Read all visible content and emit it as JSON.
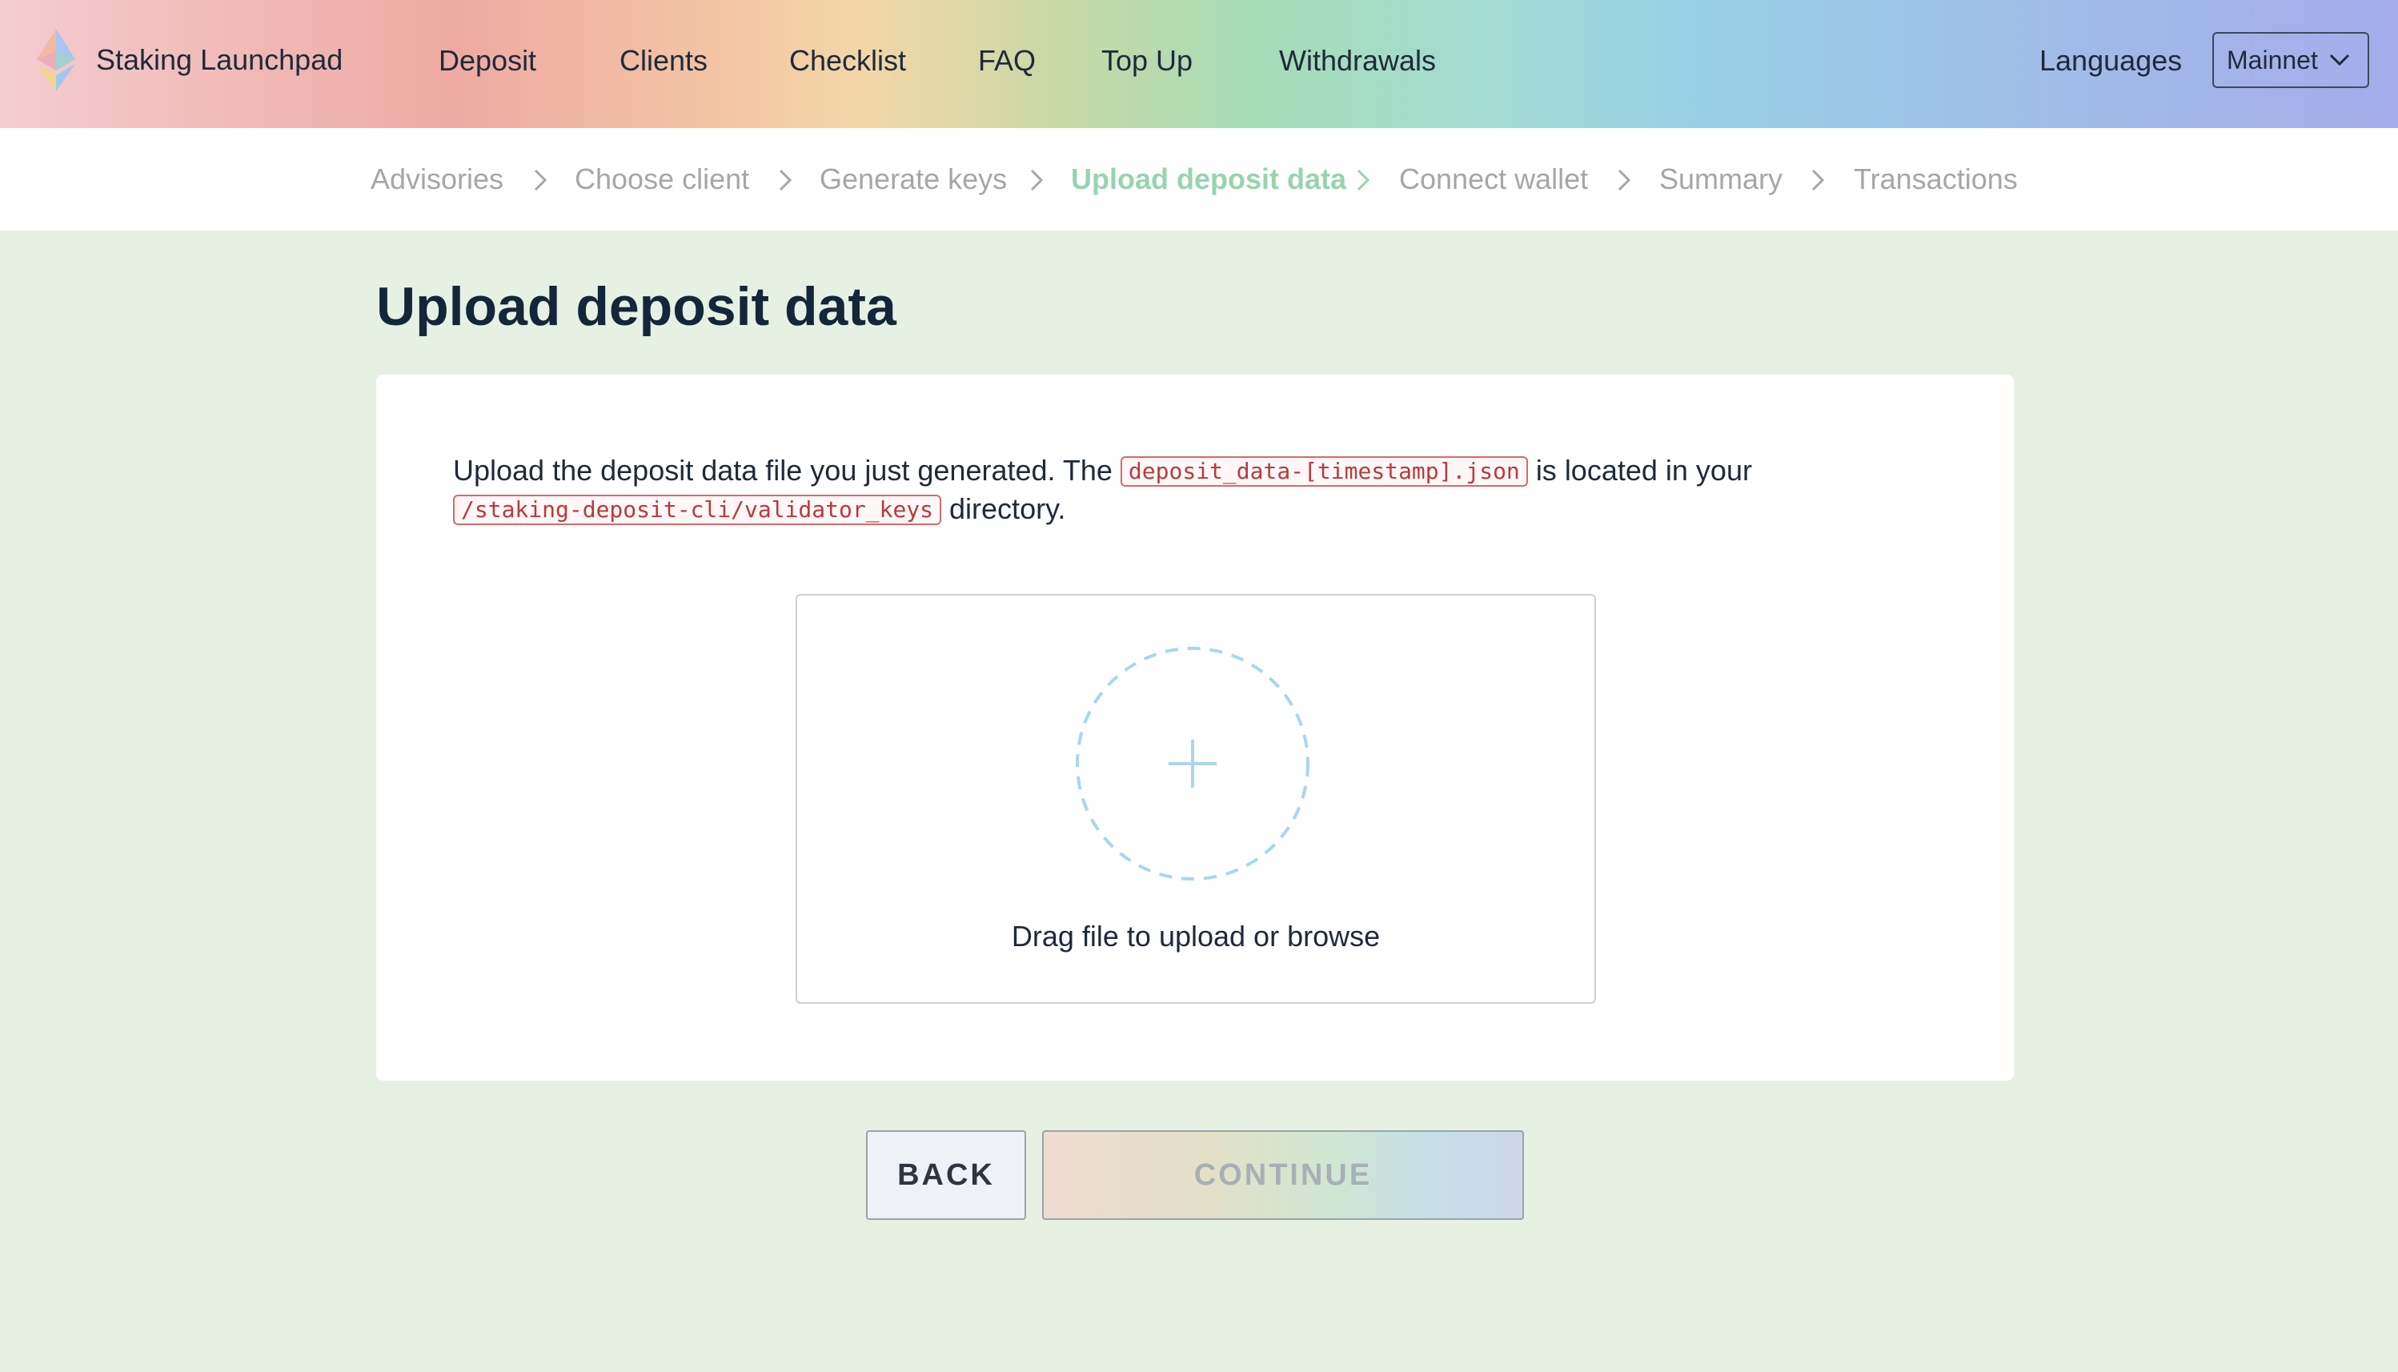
{
  "header": {
    "brand": "Staking Launchpad",
    "nav": [
      "Deposit",
      "Clients",
      "Checklist",
      "FAQ",
      "Top Up",
      "Withdrawals"
    ],
    "languages": "Languages",
    "network": "Mainnet"
  },
  "steps": {
    "items": [
      "Advisories",
      "Choose client",
      "Generate keys",
      "Upload deposit data",
      "Connect wallet",
      "Summary",
      "Transactions"
    ],
    "active": "Upload deposit data"
  },
  "main": {
    "title": "Upload deposit data",
    "instructions": {
      "text1": "Upload the deposit data file you just generated. The",
      "file_code": "deposit_data-[timestamp].json",
      "text2": "is located in your",
      "dir_code": "/staking-deposit-cli/validator_keys",
      "text3": "directory."
    },
    "dropzone": {
      "text": "Drag file to upload or browse",
      "icon": "plus-icon"
    }
  },
  "actions": {
    "back": "BACK",
    "continue": "CONTINUE",
    "continue_enabled": false
  },
  "colors": {
    "active_step": "#97d4ad",
    "page_background": "#e6f1e3",
    "code_text": "#b93a3a",
    "dropzone_accent": "#a9d6ec"
  },
  "icons": {
    "logo": "ethereum-logo",
    "dropdown": "chevron-down-icon",
    "step_separator": "chevron-right-icon"
  }
}
